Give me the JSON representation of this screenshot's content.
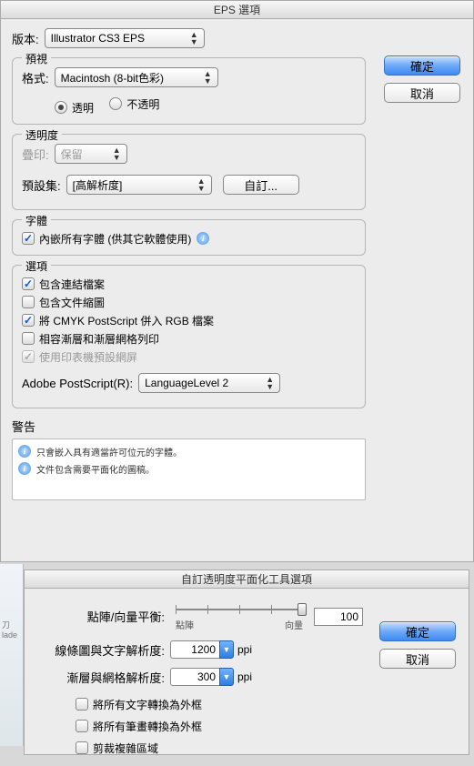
{
  "main": {
    "title": "EPS 選項",
    "version_label": "版本:",
    "version_value": "Illustrator CS3 EPS",
    "ok": "確定",
    "cancel": "取消",
    "preview": {
      "legend": "預視",
      "format_label": "格式:",
      "format_value": "Macintosh (8-bit色彩)",
      "radio_transparent": "透明",
      "radio_opaque": "不透明"
    },
    "transparency": {
      "legend": "透明度",
      "overprint_label": "疊印:",
      "overprint_value": "保留",
      "preset_label": "預設集:",
      "preset_value": "[高解析度]",
      "custom_btn": "自訂..."
    },
    "fonts": {
      "legend": "字體",
      "embed_label": "內嵌所有字體 (供其它軟體使用)"
    },
    "options": {
      "legend": "選項",
      "linked": "包含連結檔案",
      "thumb": "包含文件縮圖",
      "cmyk": "將 CMYK PostScript 併入 RGB 檔案",
      "gradient": "相容漸層和漸層網格列印",
      "printer": "使用印表機預設網屏",
      "ps_label": "Adobe PostScript(R):",
      "ps_value": "LanguageLevel 2"
    },
    "warnings": {
      "label": "警告",
      "w1": "只會嵌入具有適當許可位元的字體。",
      "w2": "文件包含需要平面化的圖稿。"
    }
  },
  "flatten": {
    "title": "自訂透明度平面化工具選項",
    "balance_label": "點陣/向量平衡:",
    "left_tag": "點陣",
    "right_tag": "向量",
    "balance_value": "100",
    "line_label": "線條圖與文字解析度:",
    "line_value": "1200",
    "grad_label": "漸層與網格解析度:",
    "grad_value": "300",
    "unit": "ppi",
    "ok": "確定",
    "cancel": "取消",
    "c1": "將所有文字轉換為外框",
    "c2": "將所有筆畫轉換為外框",
    "c3": "剪裁複雜區域"
  },
  "bg_text": "刀\nlade"
}
